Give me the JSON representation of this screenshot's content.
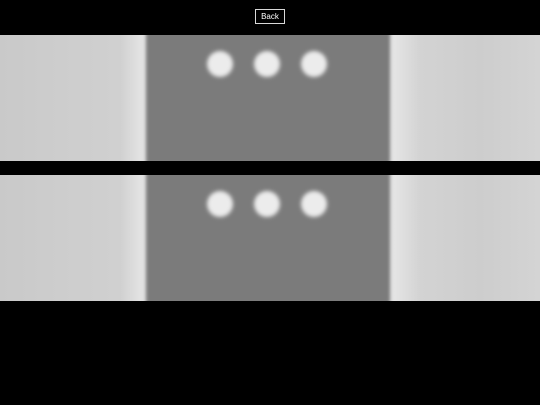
{
  "toolbar": {
    "back_label": "Back"
  },
  "images": [
    {
      "icon": "typing-indicator-icon",
      "dot_count": 3
    },
    {
      "icon": "typing-indicator-icon",
      "dot_count": 3
    }
  ],
  "colors": {
    "background": "#000000",
    "panel": "#d6d6d6",
    "bubble": "#7b7b7b",
    "dot": "#ececec"
  }
}
